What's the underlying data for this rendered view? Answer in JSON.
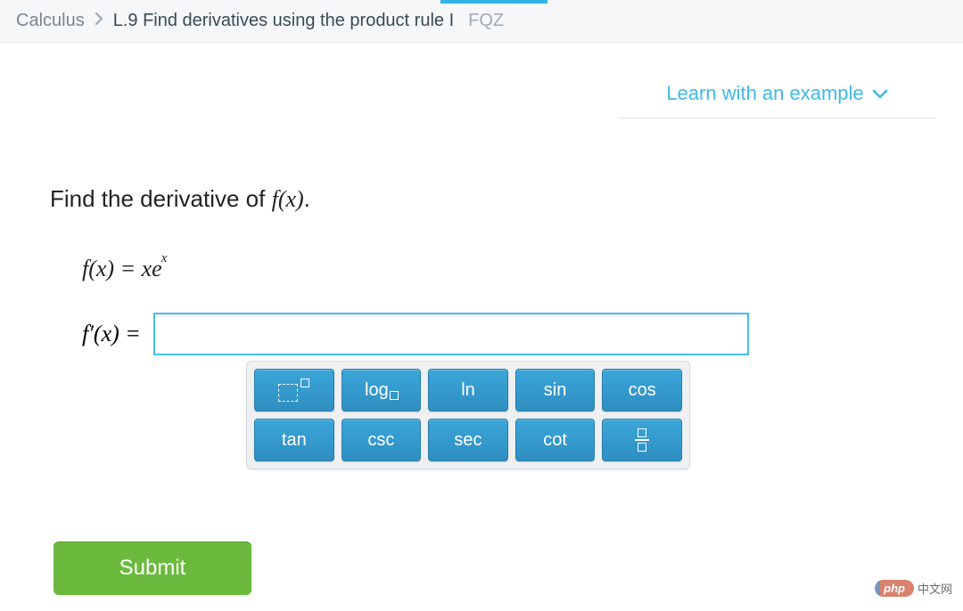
{
  "breadcrumb": {
    "course": "Calculus",
    "lesson": "L.9 Find derivatives using the product rule I",
    "code": "FQZ"
  },
  "learn_link": "Learn with an example",
  "question": {
    "prompt_prefix": "Find the derivative of ",
    "prompt_fx": "f",
    "prompt_x": "(x)",
    "prompt_suffix": "."
  },
  "equation": {
    "lhs": "f(x) = xe",
    "exp": "x"
  },
  "answer": {
    "label": "f′(x) =",
    "value": ""
  },
  "keypad": {
    "exponent_icon": "exponent",
    "log_label": "log",
    "ln_label": "ln",
    "sin_label": "sin",
    "cos_label": "cos",
    "tan_label": "tan",
    "csc_label": "csc",
    "sec_label": "sec",
    "cot_label": "cot",
    "fraction_icon": "fraction"
  },
  "submit_label": "Submit",
  "badge": {
    "pill": "php",
    "text": "中文网"
  }
}
